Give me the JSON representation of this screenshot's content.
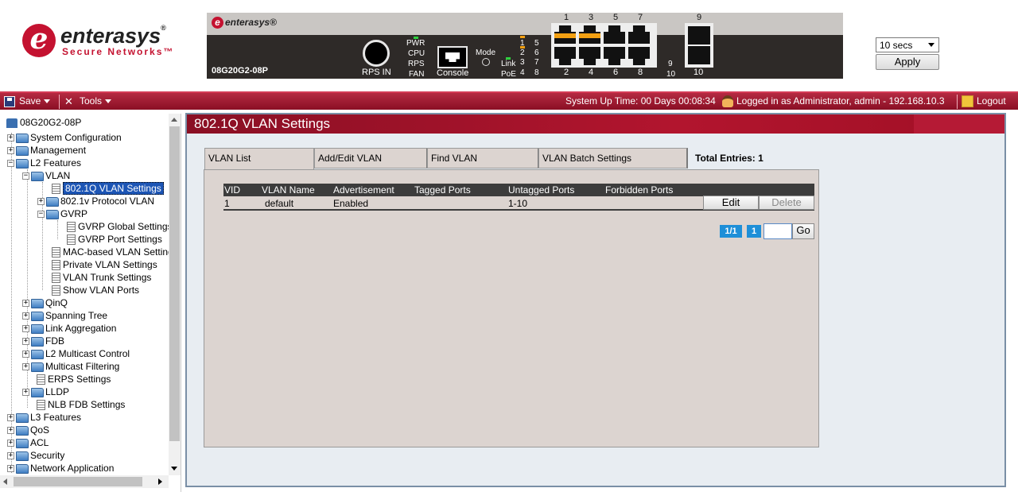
{
  "brand": {
    "mark": "e",
    "name": "enterasys",
    "trademark": "®",
    "tagline": "Secure Networks™"
  },
  "device": {
    "logo_text": "enterasys®",
    "model": "08G20G2-08P",
    "rps_label": "RPS IN",
    "console_label": "Console",
    "mode_label": "Mode",
    "status_leds": [
      "PWR",
      "CPU",
      "RPS",
      "FAN"
    ],
    "link_label": "Link",
    "poe_label": "PoE",
    "led_col1": [
      "1",
      "2",
      "3",
      "4"
    ],
    "led_col2": [
      "5",
      "6",
      "7",
      "8"
    ],
    "led_col3": [
      "9",
      "10"
    ],
    "port_top_numbers": [
      "1",
      "3",
      "5",
      "7",
      "9"
    ],
    "port_bottom_numbers": [
      "2",
      "4",
      "6",
      "8",
      "10"
    ],
    "active_ports": [
      "1",
      "3"
    ],
    "colors": {
      "active_port": "#f3a012",
      "led_green": "#2fd13f",
      "led_orange": "#f3a012"
    }
  },
  "refresh": {
    "selected": "10 secs",
    "apply_label": "Apply"
  },
  "toolbar": {
    "save_label": "Save",
    "tools_label": "Tools",
    "uptime": "System Up Time: 00 Days 00:08:34",
    "login_info": "Logged in as Administrator, admin - 192.168.10.3",
    "logout_label": "Logout",
    "colors": {
      "bar": "#8a0f24"
    }
  },
  "tree": {
    "root": "08G20G2-08P",
    "items": [
      "System Configuration",
      "Management",
      "L2 Features",
      "VLAN",
      "802.1Q VLAN Settings",
      "802.1v Protocol VLAN",
      "GVRP",
      "GVRP Global Settings",
      "GVRP Port Settings",
      "MAC-based VLAN Settings",
      "Private VLAN Settings",
      "VLAN Trunk Settings",
      "Show VLAN Ports",
      "QinQ",
      "Spanning Tree",
      "Link Aggregation",
      "FDB",
      "L2 Multicast Control",
      "Multicast Filtering",
      "ERPS Settings",
      "LLDP",
      "NLB FDB Settings",
      "L3 Features",
      "QoS",
      "ACL",
      "Security",
      "Network Application"
    ],
    "selected": "802.1Q VLAN Settings"
  },
  "page": {
    "title": "802.1Q VLAN Settings",
    "tabs": [
      "VLAN List",
      "Add/Edit VLAN",
      "Find VLAN",
      "VLAN Batch Settings"
    ],
    "active_tab": "VLAN List",
    "total_entries": "Total Entries: 1",
    "table": {
      "headers": [
        "VID",
        "VLAN Name",
        "Advertisement",
        "Tagged Ports",
        "Untagged Ports",
        "Forbidden Ports"
      ],
      "rows": [
        {
          "vid": "1",
          "name": "default",
          "advertisement": "Enabled",
          "tagged": "",
          "untagged": "1-10",
          "forbidden": ""
        }
      ],
      "edit_label": "Edit",
      "delete_label": "Delete"
    },
    "pager": {
      "page_of": "1/1",
      "current": "1",
      "go_label": "Go",
      "input_value": ""
    },
    "colors": {
      "header": "#b2152e",
      "pager": "#1e8fd8",
      "table_header": "#3c3c3c"
    }
  }
}
